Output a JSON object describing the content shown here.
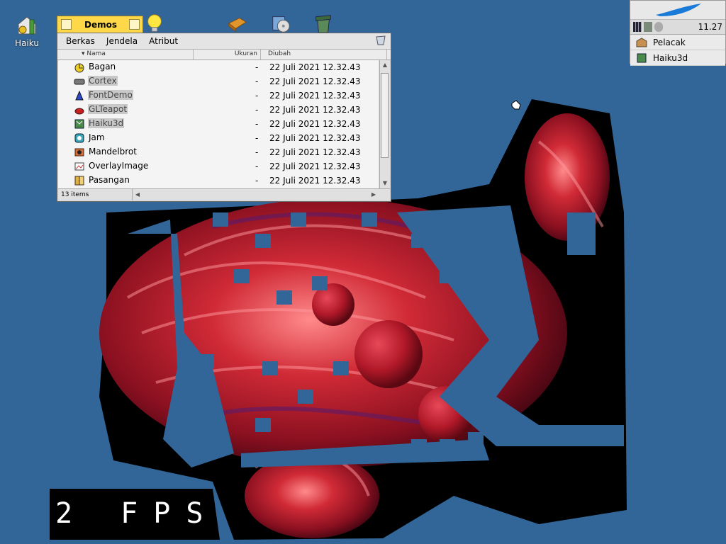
{
  "desktop": {
    "icons": [
      {
        "label": "Haiku"
      }
    ]
  },
  "fps": {
    "text": "2 FPS"
  },
  "deskbar": {
    "clock": "11.27",
    "items": [
      {
        "label": "Pelacak"
      },
      {
        "label": "Haiku3d"
      }
    ]
  },
  "window": {
    "title": "Demos",
    "menu": [
      "Berkas",
      "Jendela",
      "Atribut"
    ],
    "columns": [
      "Nama",
      "Ukuran",
      "Diubah"
    ],
    "rows": [
      {
        "name": "Bagan",
        "size": "-",
        "date": "22 Juli 2021 12.32.43",
        "selected": false
      },
      {
        "name": "Cortex",
        "size": "-",
        "date": "22 Juli 2021 12.32.43",
        "selected": true
      },
      {
        "name": "FontDemo",
        "size": "-",
        "date": "22 Juli 2021 12.32.43",
        "selected": true
      },
      {
        "name": "GLTeapot",
        "size": "-",
        "date": "22 Juli 2021 12.32.43",
        "selected": true
      },
      {
        "name": "Haiku3d",
        "size": "-",
        "date": "22 Juli 2021 12.32.43",
        "selected": true
      },
      {
        "name": "Jam",
        "size": "-",
        "date": "22 Juli 2021 12.32.43",
        "selected": false
      },
      {
        "name": "Mandelbrot",
        "size": "-",
        "date": "22 Juli 2021 12.32.43",
        "selected": false
      },
      {
        "name": "OverlayImage",
        "size": "-",
        "date": "22 Juli 2021 12.32.43",
        "selected": false
      },
      {
        "name": "Pasangan",
        "size": "-",
        "date": "22 Juli 2021 12.32.43",
        "selected": false
      }
    ],
    "status": "13 items"
  },
  "colors": {
    "desktop": "#336698",
    "tab": "#ffd84a",
    "render_red": "#b0202a"
  }
}
